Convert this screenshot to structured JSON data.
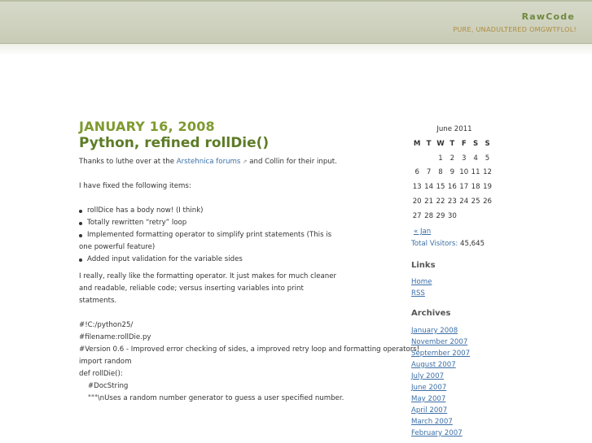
{
  "header": {
    "title": "RawCode",
    "tagline": "PURE, UNADULTERED OMGWTFLOL!"
  },
  "post": {
    "date": "JANUARY 16, 2008",
    "title": "Python, refined rollDie()",
    "intro_before": "Thanks to luthe over at the ",
    "intro_link": "Arstehnica forums",
    "intro_after": " and Collin for their input.",
    "fixed_intro": "I have fixed the following items:",
    "items": [
      "rollDice has a body now! (I think)",
      "Totally rewritten “retry” loop",
      "Implemented formatting operator to simplify print statements (This is",
      "Added input validation for the variable sides"
    ],
    "item_continuation": "one powerful feature)",
    "para_lines": [
      "I really, really like the formatting operator. It just makes for much cleaner",
      "and readable, reliable code; versus inserting variables into print",
      "statments."
    ],
    "code_lines": [
      "#!C:/python25/",
      "#filename:rollDie.py",
      "#Version 0.6 - Improved error checking of sides, a improved retry loop and formatting operators!",
      "",
      "import random",
      "",
      "def rollDie():",
      "    #DocString",
      "    \"\"\"\\nUses a random number generator to guess a user specified number."
    ]
  },
  "calendar": {
    "title": "June 2011",
    "days": [
      "M",
      "T",
      "W",
      "T",
      "F",
      "S",
      "S"
    ],
    "weeks": [
      [
        "",
        "",
        "1",
        "2",
        "3",
        "4",
        "5"
      ],
      [
        "6",
        "7",
        "8",
        "9",
        "10",
        "11",
        "12"
      ],
      [
        "13",
        "14",
        "15",
        "16",
        "17",
        "18",
        "19"
      ],
      [
        "20",
        "21",
        "22",
        "23",
        "24",
        "25",
        "26"
      ],
      [
        "27",
        "28",
        "29",
        "30",
        "",
        "",
        ""
      ]
    ],
    "prev": "« Jan"
  },
  "visitors": {
    "label": "Total Visitors:",
    "value": "45,645"
  },
  "links": {
    "heading": "Links",
    "items": [
      "Home",
      "RSS"
    ]
  },
  "archives": {
    "heading": "Archives",
    "items": [
      "January 2008",
      "November 2007",
      "September 2007",
      "August 2007",
      "July 2007",
      "June 2007",
      "May 2007",
      "April 2007",
      "March 2007",
      "February 2007"
    ]
  },
  "colors": {
    "accent": "#7f9a30",
    "link": "#3b6fa7",
    "tagline": "#b08b3e"
  }
}
